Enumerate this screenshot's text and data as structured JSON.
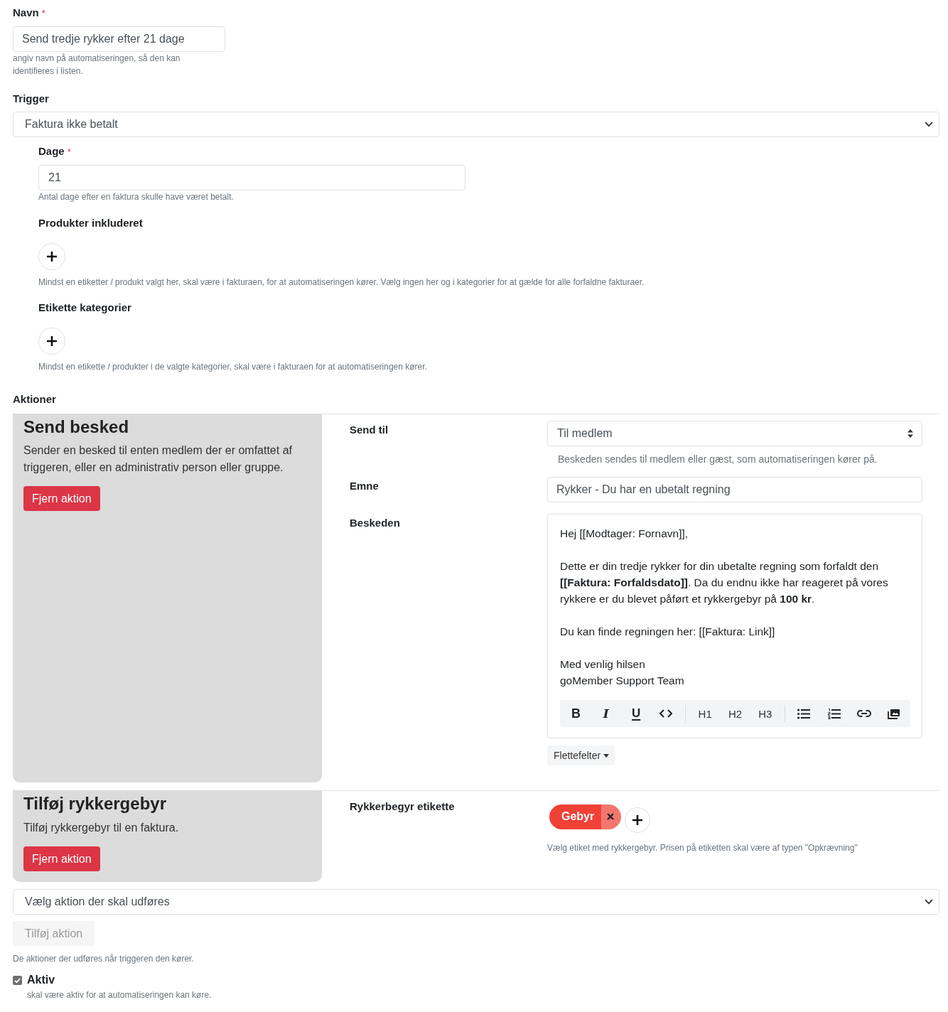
{
  "name_field": {
    "label": "Navn",
    "required_mark": "*",
    "value": "Send tredje rykker efter 21 dage",
    "help": "angiv navn på automatiseringen, så den kan identifieres i listen."
  },
  "trigger": {
    "label": "Trigger",
    "value": "Faktura ikke betalt"
  },
  "trigger_settings": {
    "days": {
      "label": "Dage",
      "required_mark": "*",
      "value": "21",
      "help": "Antal dage efter en faktura skulle have været betalt."
    },
    "pickers": [
      {
        "label": "Produkter inkluderet",
        "help": "Mindst en etiketter / produkt valgt her, skal være i fakturaen, for at automatiseringen kører. Vælg ingen her og i kategorier for at gælde for alle forfaldne fakturaer."
      },
      {
        "label": "Etikette kategorier",
        "help": "Mindst en etikette / produkter i de valgte kategorier, skal være i fakturaen for at automatiseringen kører."
      }
    ]
  },
  "actions": {
    "label": "Aktioner",
    "items": [
      {
        "title": "Send besked",
        "description": "Sender en besked til enten medlem der er omfattet af triggeren, eller en administrativ person eller gruppe.",
        "remove_button": "Fjern aktion",
        "fields": [
          {
            "kind": "select",
            "label": "Send til",
            "value": "Til medlem",
            "help": "Beskeden sendes til medlem eller gæst, som automatiseringen kører på."
          },
          {
            "kind": "input",
            "label": "Emne",
            "value": "Rykker - Du har en ubetalt regning"
          },
          {
            "kind": "editor",
            "label": "Beskeden",
            "paragraphs": [
              "Hej [[Modtager: Fornavn]],",
              "Dette er din tredje rykker for din ubetalte regning som forfaldt den **[[Faktura: Forfaldsdato]]**. Da du endnu ikke har reageret på vores rykkere er du blevet påført et rykkergebyr på **100 kr**.",
              "Du kan finde regningen her: [[Faktura: Link]]",
              "Med venlig hilsen\ngoMember Support Team"
            ],
            "toolbar": [
              [
                {
                  "kind": "bold",
                  "label": "B"
                },
                {
                  "kind": "italic",
                  "label": "I"
                },
                {
                  "kind": "underline",
                  "label": "U"
                },
                {
                  "kind": "code"
                }
              ],
              [
                {
                  "kind": "heading",
                  "label": "H1"
                },
                {
                  "kind": "heading",
                  "label": "H2"
                },
                {
                  "kind": "heading",
                  "label": "H3"
                }
              ],
              [
                {
                  "kind": "bullet_list"
                },
                {
                  "kind": "ordered_list"
                },
                {
                  "kind": "link"
                },
                {
                  "kind": "image"
                }
              ]
            ],
            "merge_button": "Flettefelter"
          }
        ]
      },
      {
        "title": "Tilføj rykkergebyr",
        "description": "Tilføj rykkergebyr til en faktura.",
        "remove_button": "Fjern aktion",
        "fields": [
          {
            "kind": "tags",
            "label": "Rykkerbegyr etikette",
            "tags": [
              {
                "label": "Gebyr",
                "color": "#ef4136"
              }
            ],
            "help": "Vælg etiket med rykkergebyr. Prisen på etiketten skal være af typen \"Opkrævning\""
          }
        ]
      }
    ],
    "add_select": {
      "value": "Vælg aktion der skal udføres"
    },
    "add_button": {
      "label": "Tilføj aktion",
      "disabled": true
    },
    "help": "De aktioner der udføres når triggeren den kører."
  },
  "active": {
    "label": "Aktiv",
    "checked": true,
    "help": "skal være aktiv for at automatiseringen kan køre."
  }
}
